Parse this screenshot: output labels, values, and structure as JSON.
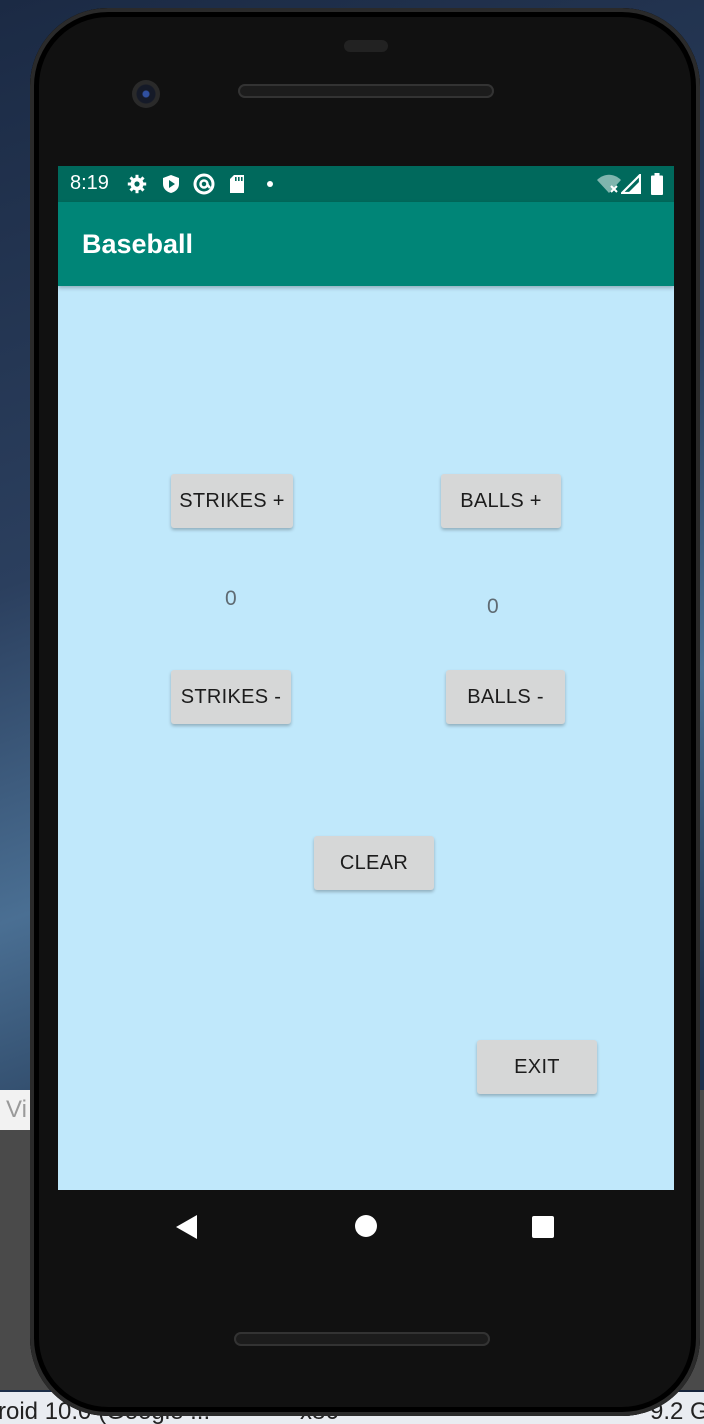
{
  "desktop": {
    "window_fragment_text": "Vi",
    "taskbar": [
      "roid 10.0 (Google ...",
      "x86",
      "9.2 G"
    ]
  },
  "status_bar": {
    "time": "8:19",
    "left_icons": [
      "gear-icon",
      "shield-play-icon",
      "at-sign-icon",
      "sd-card-icon",
      "dot-icon"
    ],
    "right_icons": [
      "wifi-off-icon",
      "signal-icon",
      "battery-icon"
    ]
  },
  "app_bar": {
    "title": "Baseball"
  },
  "buttons": {
    "strikes_plus": "STRIKES +",
    "balls_plus": "BALLS +",
    "strikes_minus": "STRIKES -",
    "balls_minus": "BALLS -",
    "clear": "CLEAR",
    "exit": "EXIT"
  },
  "counts": {
    "strikes": "0",
    "balls": "0"
  },
  "nav_bar": {
    "icons": [
      "back-icon",
      "home-icon",
      "recents-icon"
    ]
  },
  "colors": {
    "status_bar": "#00695c",
    "app_bar": "#008577",
    "screen_background": "#c0e8fb",
    "button": "#d6d7d7"
  }
}
